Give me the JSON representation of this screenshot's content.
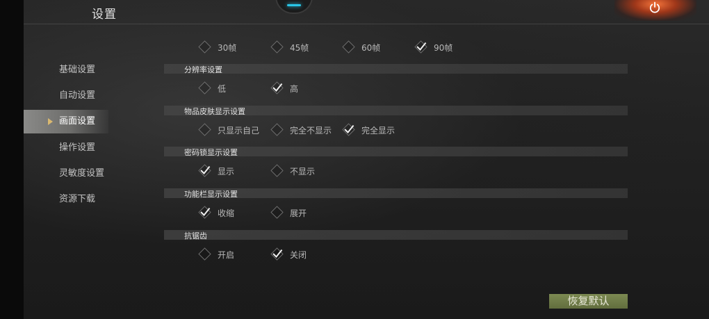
{
  "header": {
    "title": "设置"
  },
  "sidebar": {
    "items": [
      {
        "label": "基础设置",
        "active": false
      },
      {
        "label": "自动设置",
        "active": false
      },
      {
        "label": "画面设置",
        "active": true
      },
      {
        "label": "操作设置",
        "active": false
      },
      {
        "label": "灵敏度设置",
        "active": false
      },
      {
        "label": "资源下载",
        "active": false
      }
    ]
  },
  "framerate": {
    "options": [
      {
        "label": "30帧",
        "checked": false
      },
      {
        "label": "45帧",
        "checked": false
      },
      {
        "label": "60帧",
        "checked": false
      },
      {
        "label": "90帧",
        "checked": true
      }
    ]
  },
  "resolution": {
    "title": "分辨率设置",
    "options": [
      {
        "label": "低",
        "checked": false
      },
      {
        "label": "高",
        "checked": true
      }
    ]
  },
  "skin_display": {
    "title": "物品皮肤显示设置",
    "options": [
      {
        "label": "只显示自己",
        "checked": false
      },
      {
        "label": "完全不显示",
        "checked": false
      },
      {
        "label": "完全显示",
        "checked": true
      }
    ]
  },
  "lock_display": {
    "title": "密码锁显示设置",
    "options": [
      {
        "label": "显示",
        "checked": true
      },
      {
        "label": "不显示",
        "checked": false
      }
    ]
  },
  "toolbar_display": {
    "title": "功能栏显示设置",
    "options": [
      {
        "label": "收缩",
        "checked": true
      },
      {
        "label": "展开",
        "checked": false
      }
    ]
  },
  "antialias": {
    "title": "抗锯齿",
    "options": [
      {
        "label": "开启",
        "checked": false
      },
      {
        "label": "关闭",
        "checked": true
      }
    ]
  },
  "footer": {
    "restore_label": "恢复默认"
  },
  "colors": {
    "active_arrow": "#d9b870",
    "restore_button": "#6f7c47",
    "status_glow": "#29c6e8"
  }
}
